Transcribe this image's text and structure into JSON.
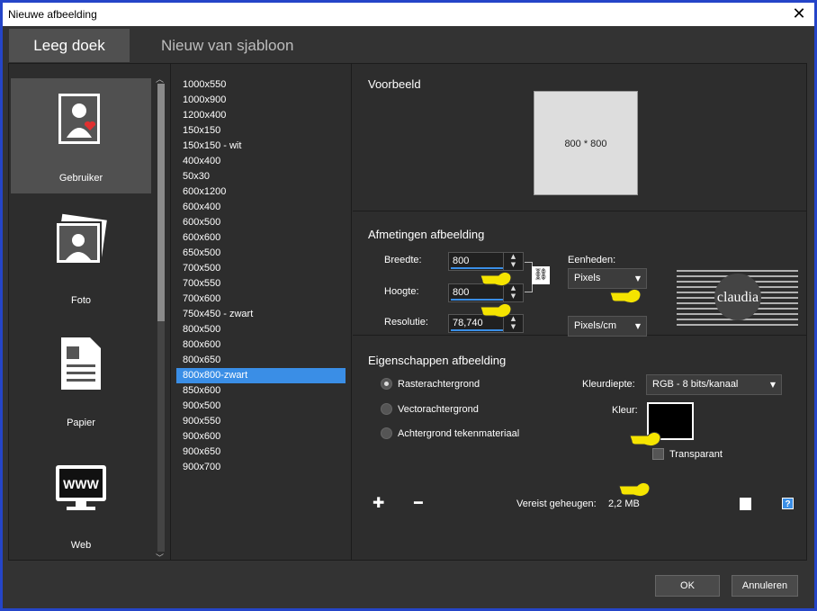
{
  "window": {
    "title": "Nieuwe afbeelding",
    "close": "✕"
  },
  "tabs": [
    {
      "label": "Leeg doek"
    },
    {
      "label": "Nieuw van sjabloon"
    }
  ],
  "categories": [
    {
      "label": "Gebruiker",
      "icon": "user-icon"
    },
    {
      "label": "Foto",
      "icon": "photo-icon"
    },
    {
      "label": "Papier",
      "icon": "paper-icon"
    },
    {
      "label": "Web",
      "icon": "web-icon",
      "text": "WWW"
    }
  ],
  "sizes": [
    "1000x550",
    "1000x900",
    "1200x400",
    "150x150",
    "150x150 - wit",
    "400x400",
    "50x30",
    "600x1200",
    "600x400",
    "600x500",
    "600x600",
    "650x500",
    "700x500",
    "700x550",
    "700x600",
    "750x450 - zwart",
    "800x500",
    "800x600",
    "800x650",
    "800x800-zwart",
    "850x600",
    "900x500",
    "900x550",
    "900x600",
    "900x650",
    "900x700"
  ],
  "selected_size": "800x800-zwart",
  "preview": {
    "header": "Voorbeeld",
    "label": "800 * 800"
  },
  "dimensions": {
    "header": "Afmetingen afbeelding",
    "width_label": "Breedte:",
    "width": "800",
    "height_label": "Hoogte:",
    "height": "800",
    "resolution_label": "Resolutie:",
    "resolution": "78,740",
    "units_label": "Eenheden:",
    "units": "Pixels",
    "res_units": "Pixels/cm"
  },
  "properties": {
    "header": "Eigenschappen afbeelding",
    "raster": "Rasterachtergrond",
    "vector": "Vectorachtergrond",
    "material": "Achtergrond tekenmateriaal",
    "depth_label": "Kleurdiepte:",
    "depth": "RGB - 8 bits/kanaal",
    "color_label": "Kleur:",
    "color": "#000000",
    "transparent": "Transparant"
  },
  "memory": {
    "label": "Vereist geheugen:",
    "value": "2,2 MB"
  },
  "buttons": {
    "ok": "OK",
    "cancel": "Annuleren"
  },
  "watermark": {
    "text": "claudia"
  },
  "colors": {
    "accent": "#3a8ee6",
    "bg": "#333333",
    "hand": "#f5e400"
  }
}
